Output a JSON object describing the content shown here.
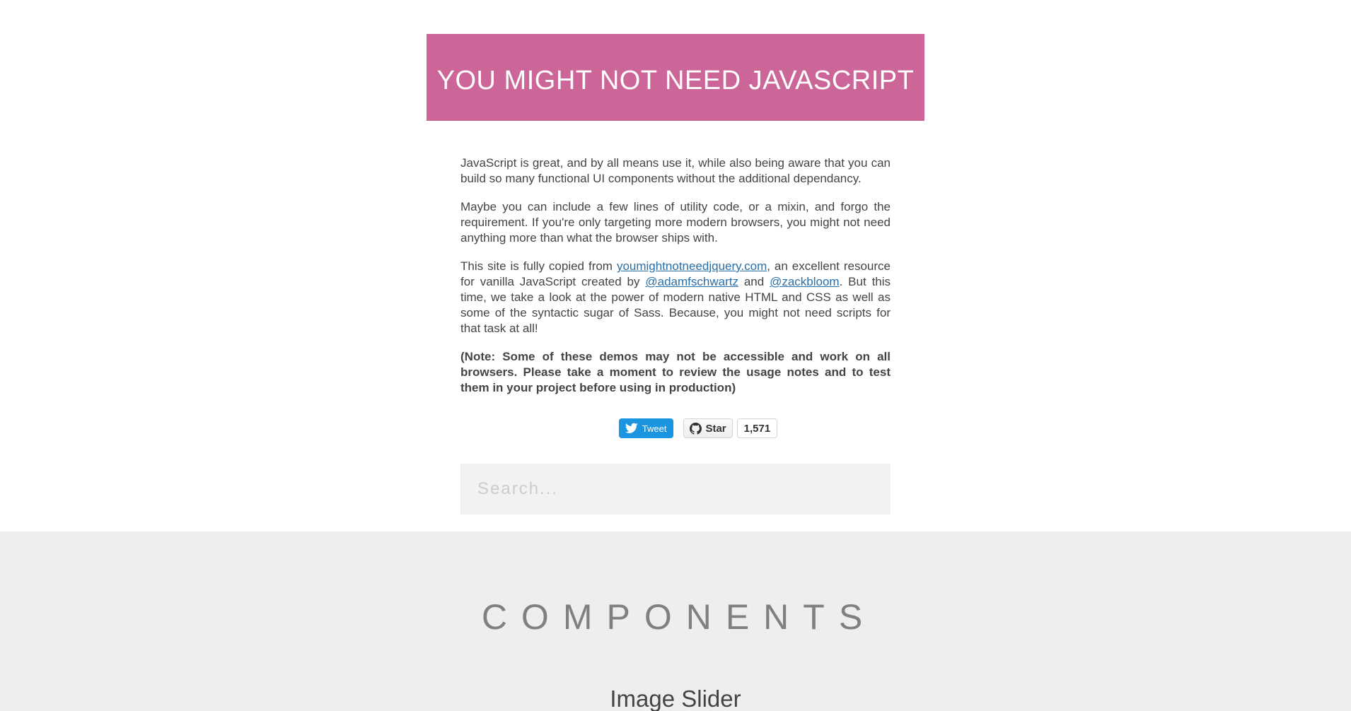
{
  "header": {
    "title": "YOU MIGHT NOT NEED JAVASCRIPT",
    "background_color": "#cc6699"
  },
  "intro": {
    "p1": "JavaScript is great, and by all means use it, while also being aware that you can build so many functional UI components without the additional dependancy.",
    "p2": "Maybe you can include a few lines of utility code, or a mixin, and forgo the requirement. If you're only targeting more modern browsers, you might not need anything more than what the browser ships with.",
    "p3_before": "This site is fully copied from ",
    "p3_link1": "youmightnotneedjquery.com",
    "p3_mid1": ", an excellent resource for vanilla JavaScript created by ",
    "p3_link2": "@adamfschwartz",
    "p3_mid2": " and ",
    "p3_link3": "@zackbloom",
    "p3_after": ". But this time, we take a look at the power of modern native HTML and CSS as well as some of the syntactic sugar of Sass. Because, you might not need scripts for that task at all!",
    "note": "(Note: Some of these demos may not be accessible and work on all browsers. Please take a moment to review the usage notes and to test them in your project before using in production)",
    "link_color": "#2a6fa8"
  },
  "social": {
    "tweet_label": "Tweet",
    "tweet_color": "#1b95e0",
    "star_label": "Star",
    "star_count": "1,571"
  },
  "search": {
    "placeholder": "Search..."
  },
  "components": {
    "heading": "COMPONENTS",
    "first_section_title": "Image Slider",
    "background_color": "#eeeeee"
  }
}
